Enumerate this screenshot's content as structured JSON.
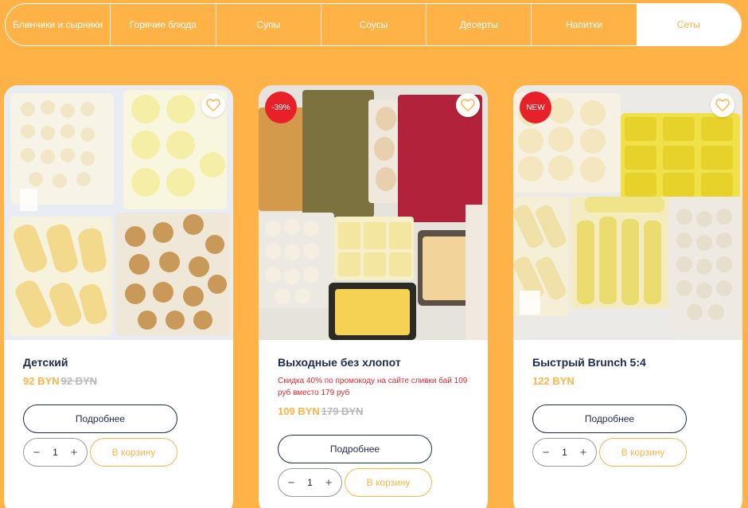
{
  "nav": {
    "tabs": [
      {
        "label": "Блинчики и сырники"
      },
      {
        "label": "Горячие блюда"
      },
      {
        "label": "Супы"
      },
      {
        "label": "Соусы"
      },
      {
        "label": "Десерты"
      },
      {
        "label": "Напитки"
      },
      {
        "label": "Сеты",
        "active": true
      }
    ]
  },
  "colors": {
    "background": "#ffb347",
    "accent": "#ffb347",
    "title": "#1f2a4e",
    "badge": "#e8202a",
    "old_price": "#b8b8b8"
  },
  "products": [
    {
      "name": "Детский",
      "price": "92 BYN",
      "old_price": "92 BYN",
      "promo": "",
      "badge": "",
      "details_label": "Подробнее",
      "qty": "1",
      "cart_label": "В корзину",
      "fav_icon": "heart-icon"
    },
    {
      "name": "Выходные без хлопот",
      "price": "109 BYN",
      "old_price": "179 BYN",
      "promo": "Скидка 40% по промокоду на сайте сливки бай 109 руб вместо 179 руб",
      "badge": "-39%",
      "details_label": "Подробнее",
      "qty": "1",
      "cart_label": "В корзину",
      "fav_icon": "heart-icon"
    },
    {
      "name": "Быстрый Brunch 5:4",
      "price": "122 BYN",
      "old_price": "",
      "promo": "",
      "badge": "NEW",
      "details_label": "Подробнее",
      "qty": "1",
      "cart_label": "В корзину",
      "fav_icon": "heart-icon"
    }
  ],
  "stepper": {
    "minus_icon": "minus-icon",
    "plus_icon": "plus-icon"
  }
}
